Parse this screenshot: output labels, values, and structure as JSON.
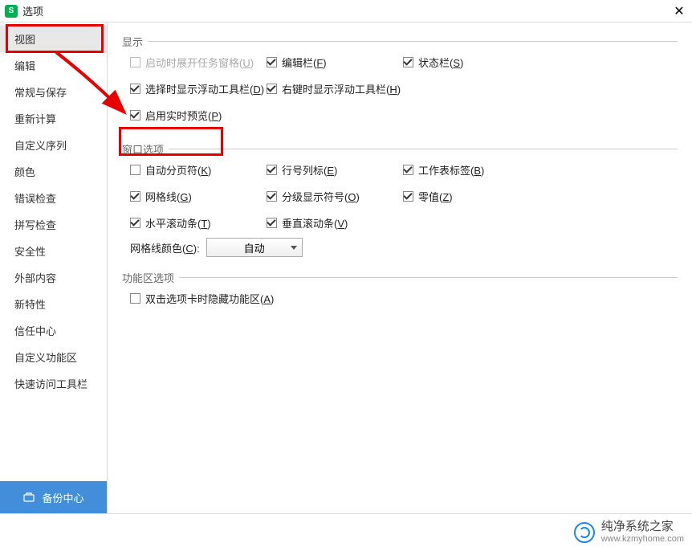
{
  "titlebar": {
    "title": "选项"
  },
  "sidebar": {
    "items": [
      {
        "label": "视图",
        "active": true
      },
      {
        "label": "编辑"
      },
      {
        "label": "常规与保存"
      },
      {
        "label": "重新计算"
      },
      {
        "label": "自定义序列"
      },
      {
        "label": "颜色"
      },
      {
        "label": "错误检查"
      },
      {
        "label": "拼写检查"
      },
      {
        "label": "安全性"
      },
      {
        "label": "外部内容"
      },
      {
        "label": "新特性"
      },
      {
        "label": "信任中心"
      },
      {
        "label": "自定义功能区"
      },
      {
        "label": "快速访问工具栏"
      }
    ],
    "backup_label": "备份中心"
  },
  "sections": {
    "display": {
      "legend": "显示",
      "opt_task_pane": "启动时展开任务窗格(",
      "opt_task_pane_u": "U",
      "opt_task_pane_end": ")",
      "opt_edit_bar": "编辑栏(",
      "opt_edit_bar_u": "F",
      "opt_edit_bar_end": ")",
      "opt_status_bar": "状态栏(",
      "opt_status_bar_u": "S",
      "opt_status_bar_end": ")",
      "opt_sel_float": "选择时显示浮动工具栏(",
      "opt_sel_float_u": "D",
      "opt_sel_float_end": ")",
      "opt_right_float": "右键时显示浮动工具栏(",
      "opt_right_float_u": "H",
      "opt_right_float_end": ")",
      "opt_live_preview": "启用实时预览(",
      "opt_live_preview_u": "P",
      "opt_live_preview_end": ")"
    },
    "window": {
      "legend": "窗口选项",
      "opt_page_break": "自动分页符(",
      "opt_page_break_u": "K",
      "opt_page_break_end": ")",
      "opt_row_col": "行号列标(",
      "opt_row_col_u": "E",
      "opt_row_col_end": ")",
      "opt_sheet_tab": "工作表标签(",
      "opt_sheet_tab_u": "B",
      "opt_sheet_tab_end": ")",
      "opt_gridlines": "网格线(",
      "opt_gridlines_u": "G",
      "opt_gridlines_end": ")",
      "opt_outline": "分级显示符号(",
      "opt_outline_u": "O",
      "opt_outline_end": ")",
      "opt_zero": "零值(",
      "opt_zero_u": "Z",
      "opt_zero_end": ")",
      "opt_hscroll": "水平滚动条(",
      "opt_hscroll_u": "T",
      "opt_hscroll_end": ")",
      "opt_vscroll": "垂直滚动条(",
      "opt_vscroll_u": "V",
      "opt_vscroll_end": ")",
      "grid_color_label": "网格线颜色(",
      "grid_color_u": "C",
      "grid_color_end": "):",
      "grid_color_value": "自动"
    },
    "ribbon": {
      "legend": "功能区选项",
      "opt_dblclick": "双击选项卡时隐藏功能区(",
      "opt_dblclick_u": "A",
      "opt_dblclick_end": ")"
    }
  },
  "watermark": {
    "line1": "纯净系统之家",
    "line2": "www.kzmyhome.com"
  }
}
